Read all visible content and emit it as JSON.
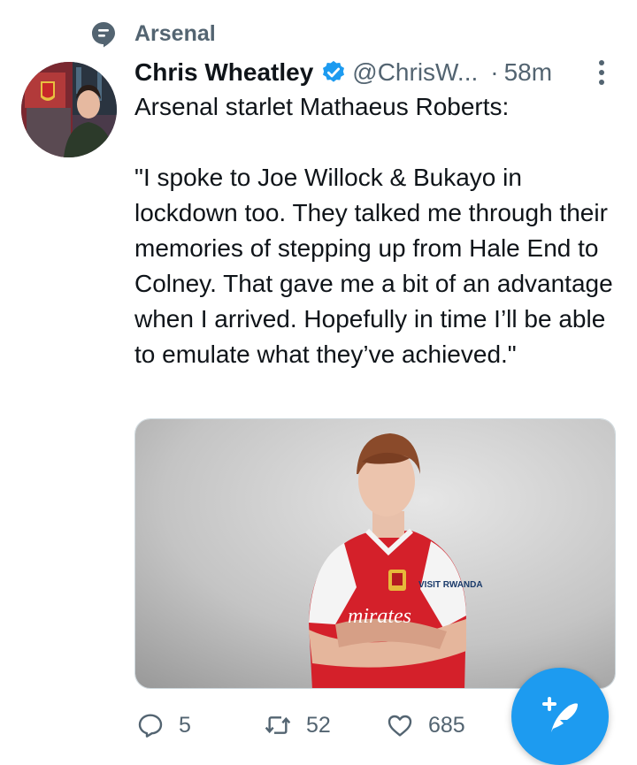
{
  "topic": {
    "label": "Arsenal",
    "icon": "topic-icon"
  },
  "tweet": {
    "author_name": "Chris Wheatley",
    "verified": true,
    "handle": "@ChrisW...",
    "separator": "·",
    "time": "58m",
    "text": "Arsenal starlet Mathaeus Roberts:\n\n\"I spoke to Joe Willock & Bukayo in lockdown too. They talked me through their memories of stepping up from Hale End to Colney. That gave me a bit of an advantage when I arrived. Hopefully in time I’ll be able to emulate what they’ve achieved.\"",
    "media": {
      "shirt_sponsor": "mirates",
      "sleeve_text": "VISIT RWANDA"
    }
  },
  "actions": {
    "replies": "5",
    "retweets": "52",
    "likes": "685"
  },
  "colors": {
    "accent": "#1d9bf0",
    "secondary_text": "#536471",
    "primary_text": "#0f1419",
    "kit_red": "#d4202a"
  },
  "icons": [
    "topic-icon",
    "verified-icon",
    "more-icon",
    "reply-icon",
    "retweet-icon",
    "like-icon",
    "compose-icon"
  ]
}
